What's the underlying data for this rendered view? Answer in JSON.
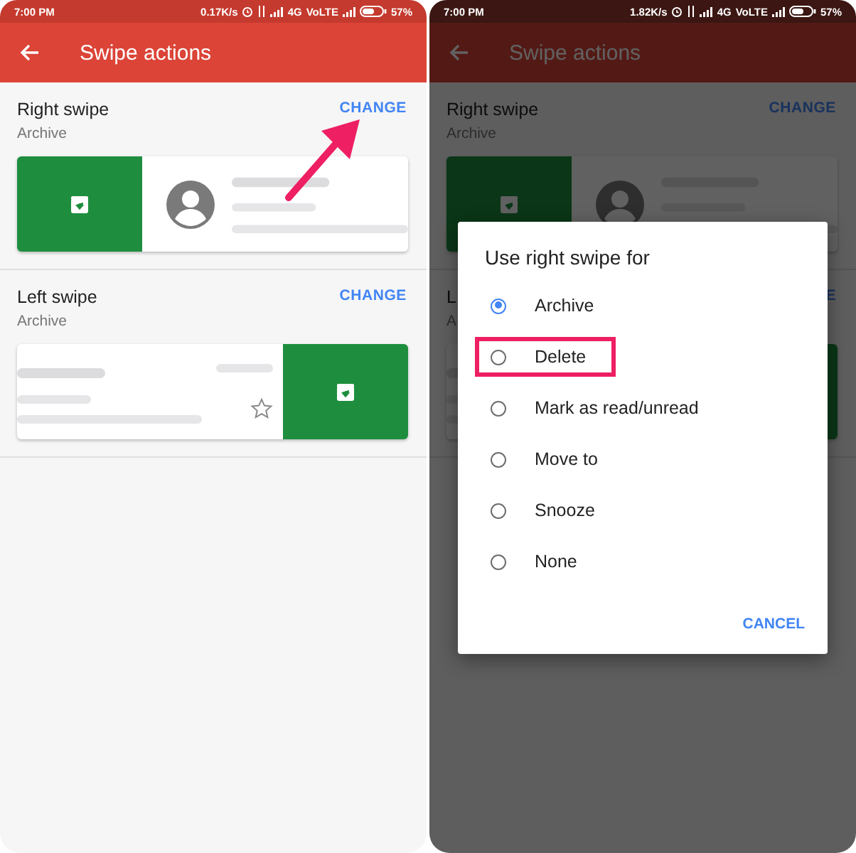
{
  "screens": [
    {
      "dimmed": false,
      "status_bar": {
        "time": "7:00 PM",
        "speed": "0.17K/s",
        "network": "4G",
        "volte": "VoLTE",
        "battery": "57%"
      },
      "app_bar": {
        "title": "Swipe actions"
      },
      "sections": [
        {
          "title": "Right swipe",
          "value": "Archive",
          "action": "CHANGE",
          "kind": "leading"
        },
        {
          "title": "Left swipe",
          "value": "Archive",
          "action": "CHANGE",
          "kind": "trailing"
        }
      ],
      "annotation": {
        "kind": "arrow"
      }
    },
    {
      "dimmed": true,
      "status_bar": {
        "time": "7:00 PM",
        "speed": "1.82K/s",
        "network": "4G",
        "volte": "VoLTE",
        "battery": "57%"
      },
      "app_bar": {
        "title": "Swipe actions"
      },
      "sections": [
        {
          "title": "Right swipe",
          "value": "Archive",
          "action": "CHANGE",
          "kind": "leading"
        },
        {
          "title": "L",
          "value": "A",
          "action": "E",
          "kind": "trailing"
        }
      ],
      "dialog": {
        "title": "Use right swipe for",
        "options": [
          {
            "label": "Archive",
            "selected": true,
            "highlighted": false
          },
          {
            "label": "Delete",
            "selected": false,
            "highlighted": true
          },
          {
            "label": "Mark as read/unread",
            "selected": false,
            "highlighted": false
          },
          {
            "label": "Move to",
            "selected": false,
            "highlighted": false
          },
          {
            "label": "Snooze",
            "selected": false,
            "highlighted": false
          },
          {
            "label": "None",
            "selected": false,
            "highlighted": false
          }
        ],
        "button": "CANCEL"
      }
    }
  ]
}
